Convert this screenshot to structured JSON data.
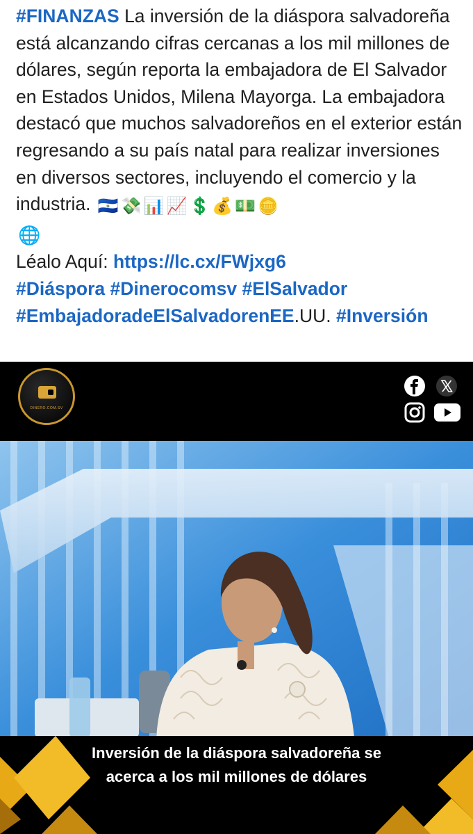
{
  "post": {
    "hashtag_lead": "#FINANZAS",
    "body": " La inversión de la diáspora salvadoreña está alcanzando cifras cercanas a los mil millones de dólares, según reporta la embajadora de El Salvador en Estados Unidos, Milena Mayorga. La embajadora destacó que muchos salvadoreños en el exterior están regresando a su país natal para realizar inversiones en diversos sectores, incluyendo el comercio y la industria.",
    "emojis": [
      "🇸🇻",
      "💸",
      "📊",
      "📈",
      "💲",
      "💰",
      "💵",
      "🪙"
    ],
    "globe_emoji": "🌐",
    "read_label": "Léalo Aquí: ",
    "link": "https://lc.cx/FWjxg6",
    "hashtags_line1": [
      "#Diáspora",
      "#Dinerocomsv",
      "#ElSalvador"
    ],
    "hashtag_embajadora": "#EmbajadoradeElSalvadorenEE",
    "hashtag_embajadora_suffix": ".UU.",
    "hashtag_inversion": "#Inversión"
  },
  "card": {
    "logo_text": "DINERO.COM.SV",
    "caption_line1": "Inversión de la diáspora salvadoreña se",
    "caption_line2": "acerca a los mil millones de dólares",
    "accent_color": "#d9a538"
  }
}
